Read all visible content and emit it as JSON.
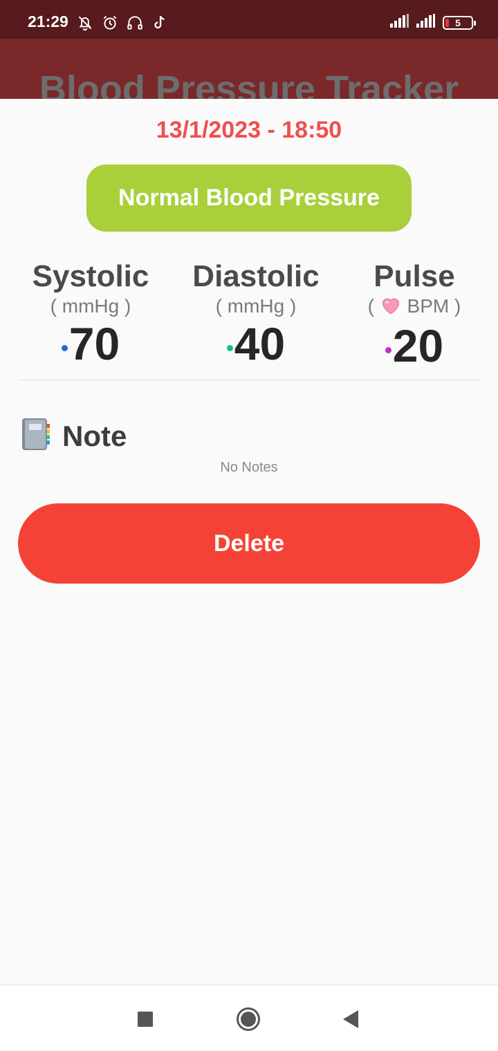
{
  "status_bar": {
    "time": "21:29",
    "battery": "5",
    "icons_left": [
      "bell-off-icon",
      "alarm-icon",
      "headset-icon",
      "tiktok-icon"
    ],
    "icons_right": [
      "signal-icon",
      "signal-icon",
      "battery-icon"
    ]
  },
  "app_bar": {
    "title": "Blood Pressure Tracker"
  },
  "record": {
    "datetime": "13/1/2023 - 18:50",
    "status_label": "Normal Blood Pressure",
    "status_color": "#a9cf3a",
    "metrics": [
      {
        "label": "Systolic",
        "unit_open": "(",
        "unit": "mmHg",
        "unit_close": ")",
        "value": "70",
        "dot_color": "#1e6ad6"
      },
      {
        "label": "Diastolic",
        "unit_open": "(",
        "unit": "mmHg",
        "unit_close": ")",
        "value": "40",
        "dot_color": "#19c07a"
      },
      {
        "label": "Pulse",
        "unit_open": "(",
        "unit": "BPM",
        "unit_close": ")",
        "value": "20",
        "dot_color": "#c02fc8",
        "unit_icon": "heart-icon"
      }
    ]
  },
  "note": {
    "title": "Note",
    "icon": "notebook-icon",
    "text": "No Notes"
  },
  "actions": {
    "delete_label": "Delete",
    "delete_color": "#f44336"
  },
  "nav_bar": {
    "buttons": [
      "recents-button",
      "home-button",
      "back-button"
    ]
  }
}
